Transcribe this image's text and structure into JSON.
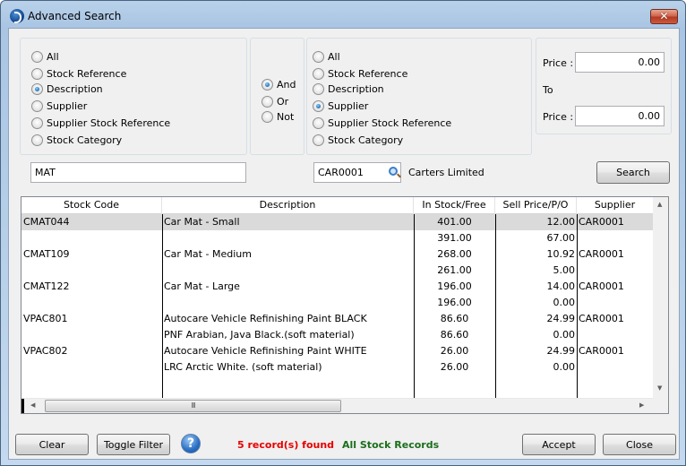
{
  "window": {
    "title": "Advanced Search",
    "close_glyph": "✕"
  },
  "criteria_left": {
    "options": [
      {
        "label": "All",
        "checked": false
      },
      {
        "label": "Stock Reference",
        "checked": false
      },
      {
        "label": "Description",
        "checked": true
      },
      {
        "label": "Supplier",
        "checked": false
      },
      {
        "label": "Supplier Stock Reference",
        "checked": false
      },
      {
        "label": "Stock Category",
        "checked": false
      }
    ],
    "value": "MAT"
  },
  "operator": {
    "options": [
      {
        "label": "And",
        "checked": true
      },
      {
        "label": "Or",
        "checked": false
      },
      {
        "label": "Not",
        "checked": false
      }
    ]
  },
  "criteria_right": {
    "options": [
      {
        "label": "All",
        "checked": false
      },
      {
        "label": "Stock Reference",
        "checked": false
      },
      {
        "label": "Description",
        "checked": false
      },
      {
        "label": "Supplier",
        "checked": true
      },
      {
        "label": "Supplier Stock Reference",
        "checked": false
      },
      {
        "label": "Stock Category",
        "checked": false
      }
    ],
    "value": "CAR0001",
    "lookup_name": "Carters Limited"
  },
  "price": {
    "from_label": "Price :",
    "from_value": "0.00",
    "to_label": "To",
    "to_price_label": "Price :",
    "to_value": "0.00"
  },
  "buttons": {
    "search": "Search",
    "clear": "Clear",
    "toggle_filter": "Toggle Filter",
    "accept": "Accept",
    "close": "Close",
    "help": "?"
  },
  "grid": {
    "columns": [
      "Stock Code",
      "Description",
      "In Stock/Free",
      "Sell Price/P/O",
      "Supplier"
    ],
    "rows": [
      [
        "CMAT044",
        "Car Mat - Small",
        "401.00",
        "12.00",
        "CAR0001"
      ],
      [
        "",
        "",
        "391.00",
        "67.00",
        ""
      ],
      [
        "CMAT109",
        "Car Mat - Medium",
        "268.00",
        "10.92",
        "CAR0001"
      ],
      [
        "",
        "",
        "261.00",
        "5.00",
        ""
      ],
      [
        "CMAT122",
        "Car Mat - Large",
        "196.00",
        "14.00",
        "CAR0001"
      ],
      [
        "",
        "",
        "196.00",
        "0.00",
        ""
      ],
      [
        "VPAC801",
        "Autocare Vehicle Refinishing Paint BLACK",
        "86.60",
        "24.99",
        "CAR0001"
      ],
      [
        "",
        "PNF Arabian, Java Black.(soft material)",
        "86.60",
        "0.00",
        ""
      ],
      [
        "VPAC802",
        "Autocare Vehicle Refinishing Paint WHITE",
        "26.00",
        "24.99",
        "CAR0001"
      ],
      [
        "",
        "LRC Arctic White. (soft material)",
        "26.00",
        "0.00",
        ""
      ]
    ],
    "selected_row": 0,
    "hscroll_grip": "III"
  },
  "status": {
    "records_found": "5 record(s) found",
    "filter": "All Stock Records",
    "records_color": "#e60000",
    "filter_color": "#1b6e1b"
  }
}
